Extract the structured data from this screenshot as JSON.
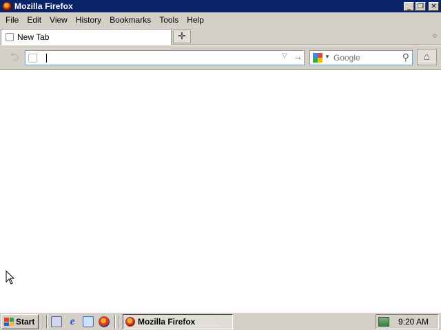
{
  "window": {
    "title": "Mozilla Firefox"
  },
  "menubar": {
    "items": [
      {
        "label": "File"
      },
      {
        "label": "Edit"
      },
      {
        "label": "View"
      },
      {
        "label": "History"
      },
      {
        "label": "Bookmarks"
      },
      {
        "label": "Tools"
      },
      {
        "label": "Help"
      }
    ]
  },
  "tabs": [
    {
      "label": "New Tab",
      "active": true
    }
  ],
  "navbar": {
    "url_value": "",
    "search_placeholder": "Google",
    "search_engine_icon": "google-icon"
  },
  "taskbar": {
    "start_label": "Start",
    "quick_launch": [
      "show-desktop-icon",
      "internet-explorer-icon",
      "view-channels-icon",
      "firefox-icon"
    ],
    "tasks": [
      {
        "label": "Mozilla Firefox",
        "active": true
      }
    ],
    "tray": {
      "clock": "9:20 AM",
      "tray_icon": "network-icon"
    }
  }
}
